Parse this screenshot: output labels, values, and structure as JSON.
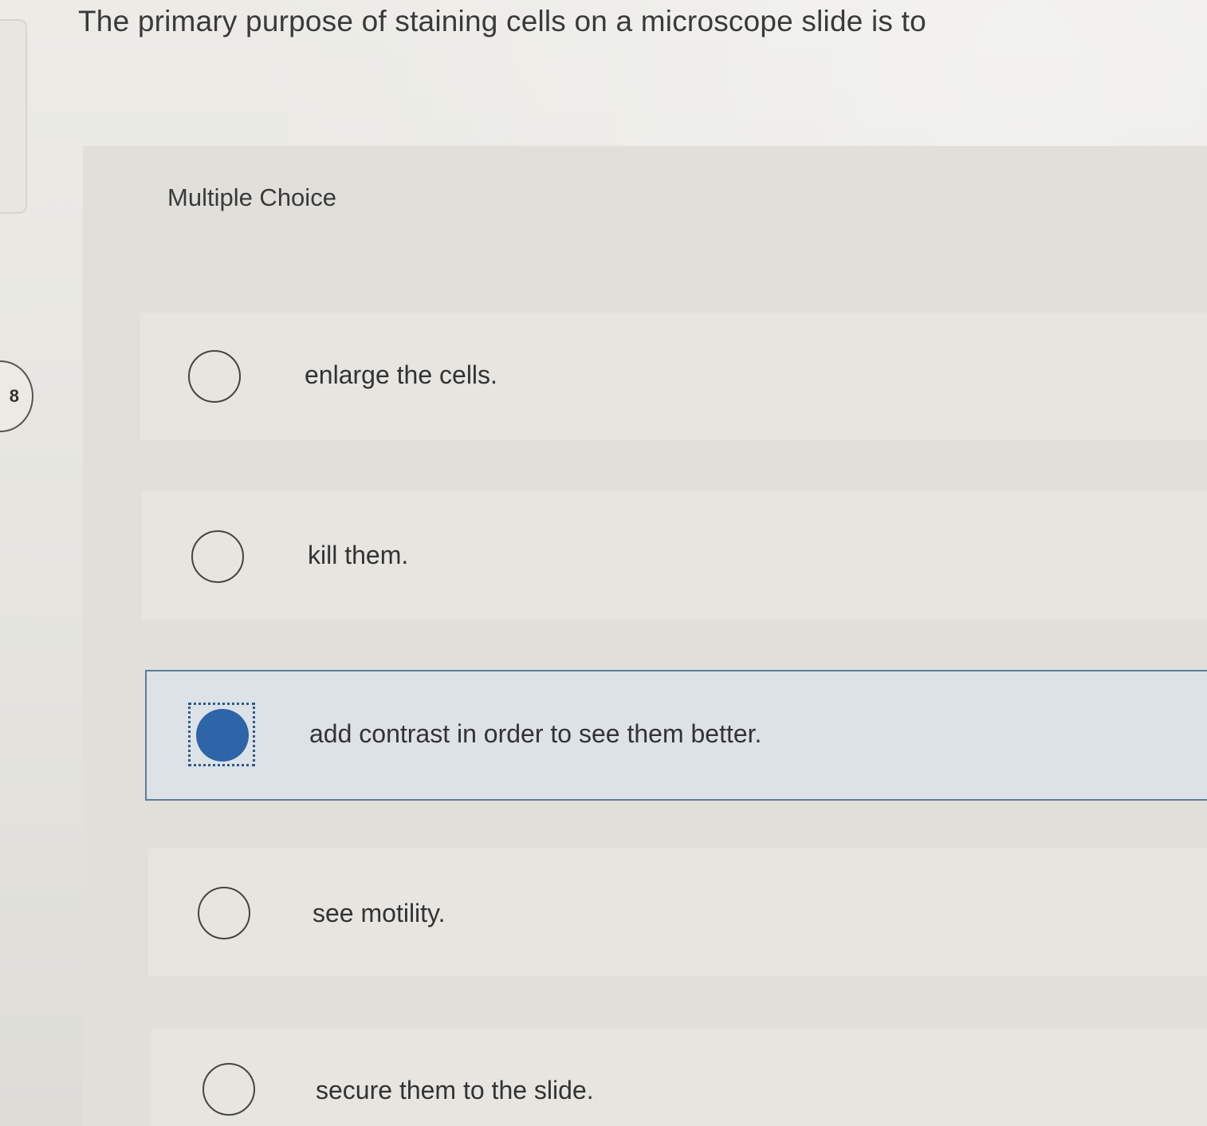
{
  "question": {
    "title": "The primary purpose of staining cells on a microscope slide is to",
    "number_badge": "8"
  },
  "quiz": {
    "type_label": "Multiple Choice",
    "options": [
      {
        "label": "enlarge the cells.",
        "selected": false
      },
      {
        "label": "kill them.",
        "selected": false
      },
      {
        "label": "add contrast in order to see them better.",
        "selected": true
      },
      {
        "label": "see motility.",
        "selected": false
      },
      {
        "label": "secure them to the slide.",
        "selected": false
      }
    ]
  },
  "colors": {
    "selected_accent": "#2e64a8",
    "selected_border": "#5a7e9c"
  }
}
